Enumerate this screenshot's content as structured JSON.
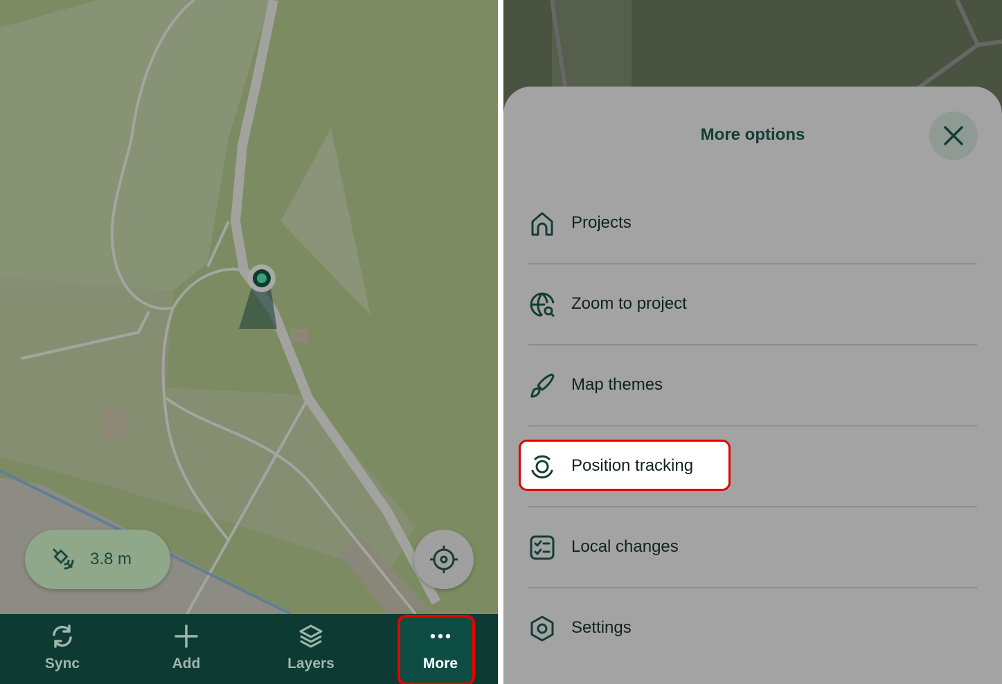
{
  "left": {
    "gps_accuracy": "3.8 m",
    "icons": {
      "gps": "satellite-icon",
      "locate": "crosshair-icon"
    },
    "nav": [
      {
        "label": "Sync",
        "icon": "sync-icon"
      },
      {
        "label": "Add",
        "icon": "plus-icon"
      },
      {
        "label": "Layers",
        "icon": "layers-icon"
      },
      {
        "label": "More",
        "icon": "more-dots-icon",
        "active": true
      }
    ]
  },
  "sheet": {
    "title": "More options",
    "close_icon": "close-icon",
    "items": [
      {
        "label": "Projects",
        "icon": "home-icon"
      },
      {
        "label": "Zoom to project",
        "icon": "globe-search-icon"
      },
      {
        "label": "Map themes",
        "icon": "brush-icon"
      },
      {
        "label": "Position tracking",
        "icon": "tracking-icon",
        "highlighted": true
      },
      {
        "label": "Local changes",
        "icon": "checklist-icon"
      },
      {
        "label": "Settings",
        "icon": "settings-icon"
      }
    ]
  },
  "colors": {
    "brand_dark": "#0d3a32",
    "highlight": "#e60000",
    "map_green": "#7d8b62"
  }
}
